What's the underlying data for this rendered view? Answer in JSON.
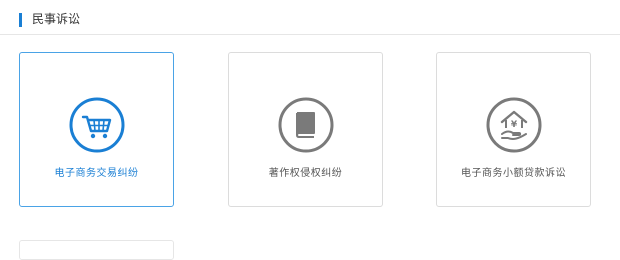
{
  "section": {
    "title": "民事诉讼"
  },
  "cards": [
    {
      "label": "电子商务交易纠纷",
      "icon": "shopping-cart-icon",
      "active": true
    },
    {
      "label": "著作权侵权纠纷",
      "icon": "book-icon",
      "active": false
    },
    {
      "label": "电子商务小额贷款诉讼",
      "icon": "loan-house-icon",
      "active": false
    }
  ],
  "colors": {
    "accent": "#1a7fd4",
    "icon_gray": "#7a7a7a",
    "border": "#dcdcdc"
  }
}
